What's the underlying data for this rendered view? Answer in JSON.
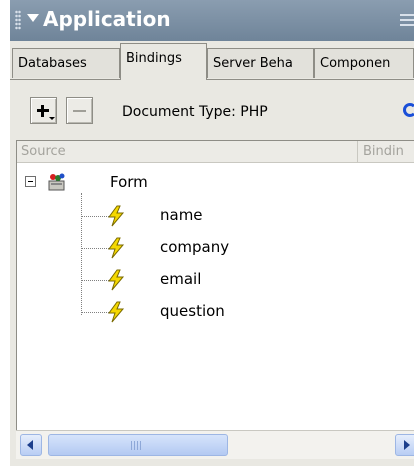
{
  "panel": {
    "title": "Application"
  },
  "tabs": [
    {
      "label": "Databases",
      "active": false
    },
    {
      "label": "Bindings",
      "active": true
    },
    {
      "label": "Server Beha",
      "active": false
    },
    {
      "label": "Componen",
      "active": false
    }
  ],
  "toolbar": {
    "add_label": "+",
    "remove_label": "—",
    "document_type": "Document Type: PHP"
  },
  "columns": {
    "source": "Source",
    "binding": "Bindin"
  },
  "tree": {
    "root": {
      "label": "Form",
      "expanded": true,
      "icon": "form-icon"
    },
    "fields": [
      {
        "label": "name",
        "icon": "bolt-icon"
      },
      {
        "label": "company",
        "icon": "bolt-icon"
      },
      {
        "label": "email",
        "icon": "bolt-icon"
      },
      {
        "label": "question",
        "icon": "bolt-icon"
      }
    ]
  },
  "scrollbar": {
    "orientation": "horizontal"
  },
  "colors": {
    "title_bar": "#7a8ea3",
    "panel_bg": "#e9e8e2",
    "refresh_icon": "#1a4fd8",
    "bolt_yellow": "#f5d800"
  }
}
